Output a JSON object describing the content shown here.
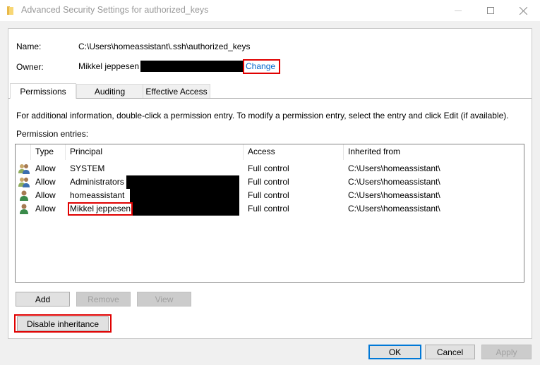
{
  "window": {
    "title": "Advanced Security Settings for authorized_keys",
    "icon": "folder-icon",
    "controls": [
      "minimize",
      "maximize",
      "close"
    ]
  },
  "info": {
    "name_label": "Name:",
    "name_value": "C:\\Users\\homeassistant\\.ssh\\authorized_keys",
    "owner_label": "Owner:",
    "owner_value": "Mikkel jeppesen",
    "owner_change_link": "Change"
  },
  "tabs": [
    {
      "label": "Permissions",
      "active": true
    },
    {
      "label": "Auditing",
      "active": false
    },
    {
      "label": "Effective Access",
      "active": false
    }
  ],
  "permissions": {
    "info_text": "For additional information, double-click a permission entry. To modify a permission entry, select the entry and click Edit (if available).",
    "entries_label": "Permission entries:",
    "columns": [
      "Type",
      "Principal",
      "Access",
      "Inherited from"
    ],
    "rows": [
      {
        "icon": "group-users-icon",
        "type": "Allow",
        "principal": "SYSTEM",
        "access": "Full control",
        "inherited_from": "C:\\Users\\homeassistant\\"
      },
      {
        "icon": "group-users-icon",
        "type": "Allow",
        "principal": "Administrators",
        "access": "Full control",
        "inherited_from": "C:\\Users\\homeassistant\\"
      },
      {
        "icon": "user-icon",
        "type": "Allow",
        "principal": "homeassistant",
        "access": "Full control",
        "inherited_from": "C:\\Users\\homeassistant\\"
      },
      {
        "icon": "user-icon",
        "type": "Allow",
        "principal": "Mikkel jeppesen",
        "access": "Full control",
        "inherited_from": "C:\\Users\\homeassistant\\"
      }
    ],
    "buttons": {
      "add": "Add",
      "remove": "Remove",
      "view": "View",
      "disable_inheritance": "Disable inheritance"
    }
  },
  "footer": {
    "ok": "OK",
    "cancel": "Cancel",
    "apply": "Apply"
  },
  "highlight_color": "#e00000",
  "link_color": "#0066cc"
}
